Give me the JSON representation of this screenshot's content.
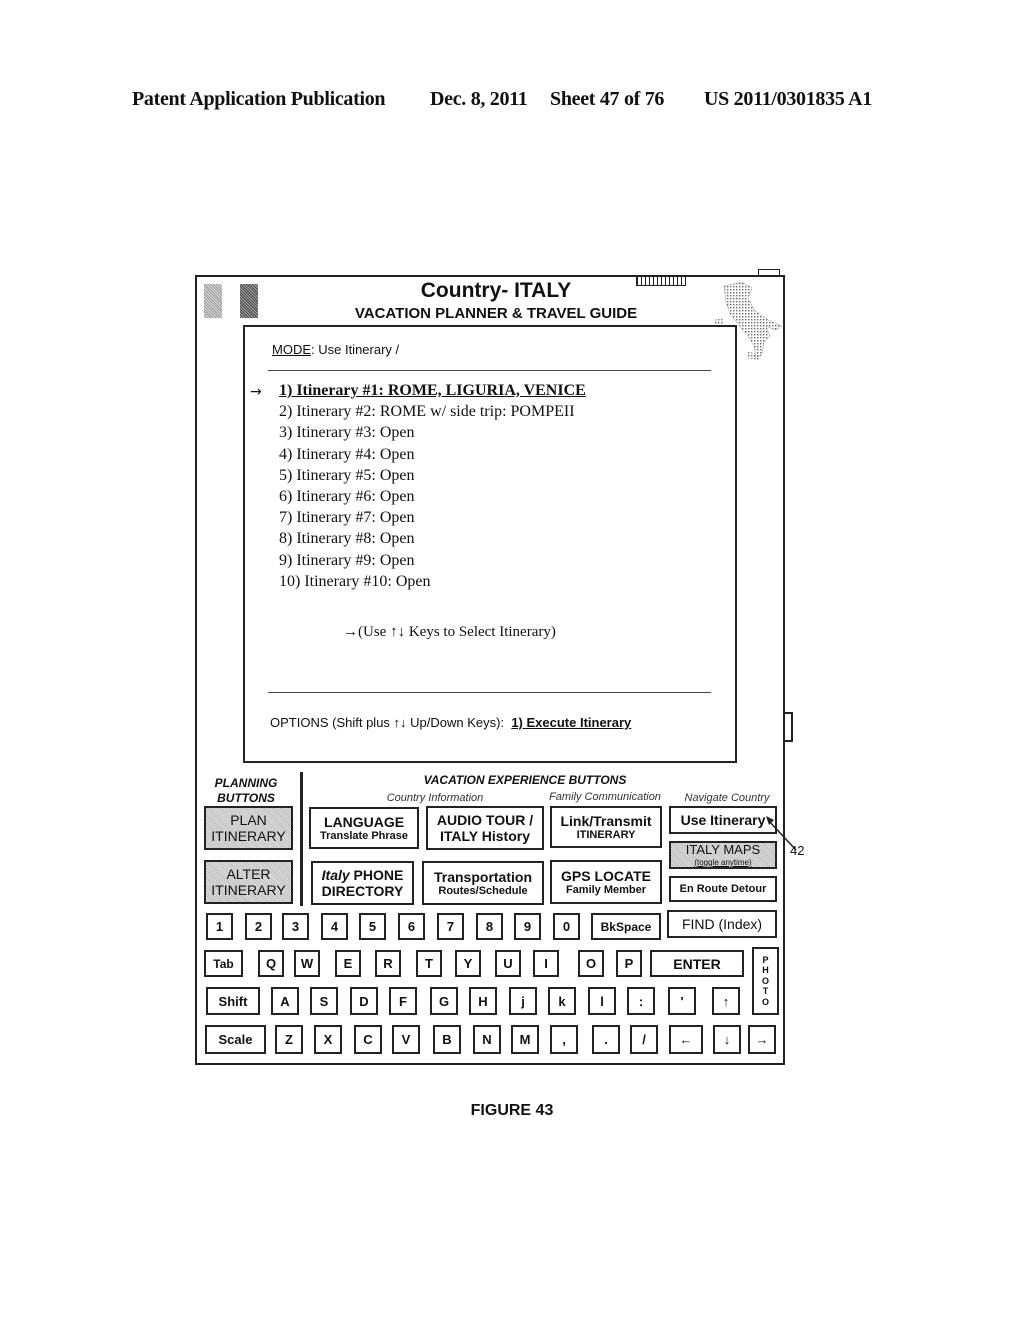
{
  "header": {
    "publication": "Patent Application Publication",
    "date": "Dec. 8, 2011",
    "sheet": "Sheet 47 of 76",
    "number": "US 2011/0301835 A1"
  },
  "device": {
    "title": "Country- ITALY",
    "subtitle": "VACATION PLANNER & TRAVEL GUIDE",
    "icons": {
      "flag": "italy-flag-icon",
      "battery": "battery-icon",
      "map": "italy-map-icon"
    }
  },
  "screen": {
    "mode_label": "MODE",
    "mode_value": ": Use Itinerary /",
    "selection_arrow": "→",
    "itineraries": [
      {
        "label": "1) Itinerary #1: ROME, LIGURIA, VENICE",
        "selected": true
      },
      {
        "label": "2) Itinerary #2: ROME w/ side trip: POMPEII",
        "selected": false
      },
      {
        "label": "3) Itinerary #3: Open",
        "selected": false
      },
      {
        "label": "4) Itinerary #4: Open",
        "selected": false
      },
      {
        "label": "5) Itinerary #5: Open",
        "selected": false
      },
      {
        "label": "6) Itinerary #6: Open",
        "selected": false
      },
      {
        "label": "7) Itinerary #7: Open",
        "selected": false
      },
      {
        "label": "8) Itinerary #8: Open",
        "selected": false
      },
      {
        "label": "9) Itinerary #9: Open",
        "selected": false
      },
      {
        "label": "10) Itinerary #10: Open",
        "selected": false
      }
    ],
    "hint": "→(Use ↑↓ Keys to Select Itinerary)",
    "options_label": "OPTIONS (Shift plus ↑↓ Up/Down Keys):",
    "options_value": "1) Execute Itinerary"
  },
  "panels": {
    "planning_title_1": "PLANNING",
    "planning_title_2": "BUTTONS",
    "vacation_title": "VACATION EXPERIENCE BUTTONS",
    "country_info": "Country Information",
    "family_comm": "Family Communication",
    "navigate_country": "Navigate Country",
    "plan_itinerary": [
      "PLAN",
      "ITINERARY"
    ],
    "alter_itinerary": [
      "ALTER",
      "ITINERARY"
    ],
    "language": [
      "LANGUAGE",
      "Translate Phrase"
    ],
    "audio_tour": [
      "AUDIO TOUR /",
      "ITALY History"
    ],
    "link_transmit": [
      "Link/Transmit",
      "ITINERARY"
    ],
    "use_itinerary": "Use Itinerary",
    "phone_directory": [
      "Italy",
      " PHONE",
      "DIRECTORY"
    ],
    "transportation": [
      "Transportation",
      "Routes/Schedule"
    ],
    "gps_locate": [
      "GPS LOCATE",
      "Family Member"
    ],
    "italy_maps": [
      "ITALY MAPS",
      "(toggle anytime)"
    ],
    "en_route": "En Route Detour"
  },
  "keyboard": {
    "row1": [
      "1",
      "2",
      "3",
      "4",
      "5",
      "6",
      "7",
      "8",
      "9",
      "0",
      "BkSpace"
    ],
    "find": "FIND (Index)",
    "row2": [
      "Tab",
      "Q",
      "W",
      "E",
      "R",
      "T",
      "Y",
      "U",
      "I",
      "O",
      "P"
    ],
    "enter": "ENTER",
    "photo": "P\nH\nO\nT\nO",
    "row3": [
      "Shift",
      "A",
      "S",
      "D",
      "F",
      "G",
      "H",
      "j",
      "k",
      "l",
      ":",
      "'",
      "↑"
    ],
    "row4": [
      "Scale",
      "Z",
      "X",
      "C",
      "V",
      "B",
      "N",
      "M",
      ",",
      ".",
      "/",
      "←",
      "↓",
      "→"
    ]
  },
  "callout": "42",
  "figure": "FIGURE 43"
}
